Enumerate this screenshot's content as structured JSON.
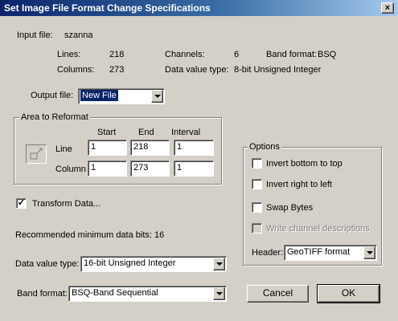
{
  "window": {
    "title": "Set Image File Format Change Specifications",
    "close_glyph": "×"
  },
  "input": {
    "label": "Input file:",
    "value": "szanna"
  },
  "info": {
    "lines_label": "Lines:",
    "lines_value": "218",
    "columns_label": "Columns:",
    "columns_value": "273",
    "channels_label": "Channels:",
    "channels_value": "6",
    "data_value_type_label": "Data value type:",
    "data_value_type_value": "8-bit Unsigned Integer",
    "band_format_label": "Band format:",
    "band_format_value": "BSQ"
  },
  "output_file": {
    "label": "Output file:",
    "selected": "New File"
  },
  "area": {
    "title": "Area to Reformat",
    "headers": {
      "start": "Start",
      "end": "End",
      "interval": "Interval"
    },
    "line": {
      "label": "Line",
      "start": "1",
      "end": "218",
      "interval": "1"
    },
    "column": {
      "label": "Column",
      "start": "1",
      "end": "273",
      "interval": "1"
    },
    "icon": "area-select-icon"
  },
  "transform": {
    "label": "Transform Data...",
    "checked": true,
    "mark": "✓"
  },
  "recommended": "Recommended minimum data bits: 16",
  "data_value_type": {
    "label": "Data value type:",
    "selected": "16-bit Unsigned Integer"
  },
  "band_format": {
    "label": "Band format:",
    "selected": "BSQ-Band Sequential"
  },
  "options": {
    "title": "Options",
    "invert_bottom": "Invert bottom to top",
    "invert_right": "Invert right to left",
    "swap_bytes": "Swap Bytes",
    "write_descriptions": "Write channel descriptions",
    "header_label": "Header:",
    "header_selected": "GeoTIFF format"
  },
  "buttons": {
    "cancel": "Cancel",
    "ok": "OK"
  },
  "colors": {
    "title_start": "#0a246a",
    "title_end": "#a6caf0",
    "face": "#d4d0c8",
    "selection": "#0a246a"
  }
}
